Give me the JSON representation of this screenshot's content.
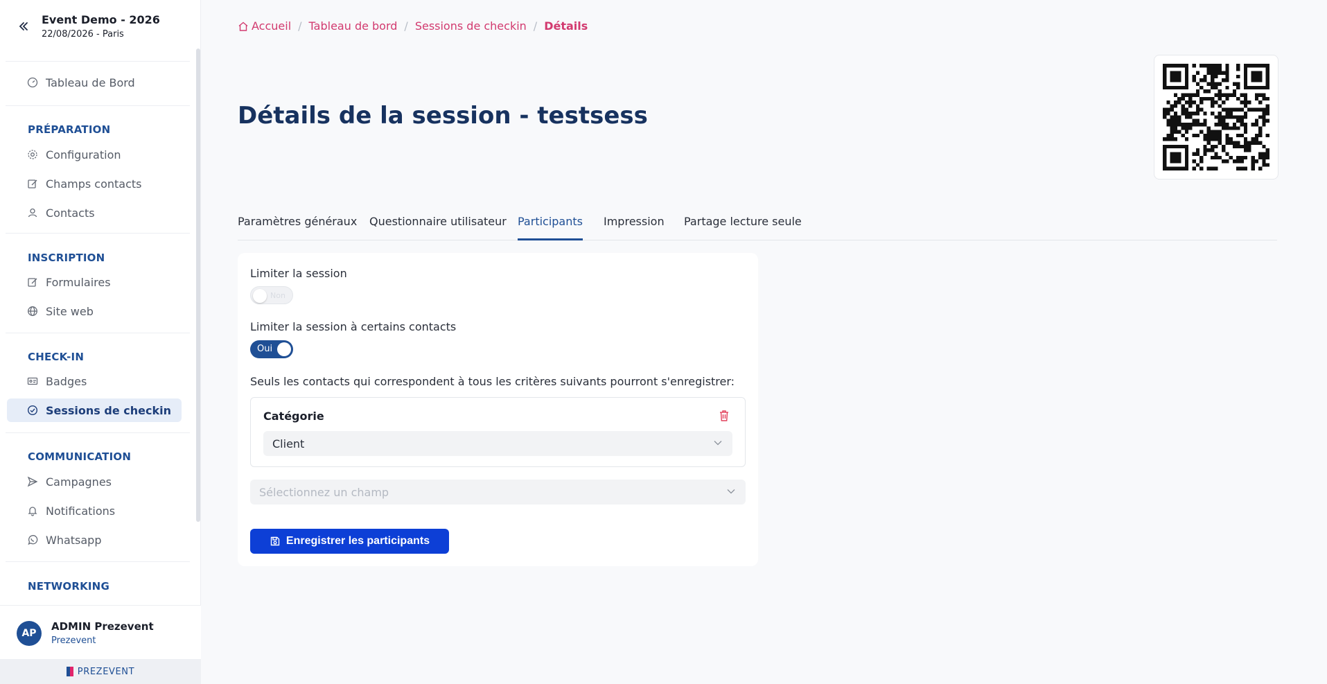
{
  "event": {
    "title": "Event Demo - 2026",
    "subtitle": "22/08/2026 - Paris"
  },
  "sidebar": {
    "dashboard": "Tableau de Bord",
    "sections": {
      "preparation": "PRÉPARATION",
      "inscription": "INSCRIPTION",
      "checkin": "CHECK-IN",
      "communication": "COMMUNICATION",
      "networking": "NETWORKING"
    },
    "items": {
      "configuration": "Configuration",
      "champs_contacts": "Champs contacts",
      "contacts": "Contacts",
      "formulaires": "Formulaires",
      "site_web": "Site web",
      "badges": "Badges",
      "sessions_checkin": "Sessions de checkin",
      "campagnes": "Campagnes",
      "notifications": "Notifications",
      "whatsapp": "Whatsapp"
    }
  },
  "user": {
    "initials": "AP",
    "name": "ADMIN Prezevent",
    "org": "Prezevent"
  },
  "brand": "PREZEVENT",
  "breadcrumb": {
    "home": "Accueil",
    "dashboard": "Tableau de bord",
    "sessions": "Sessions de checkin",
    "current": "Détails"
  },
  "page": {
    "title": "Détails de la session - testsess"
  },
  "tabs": {
    "general": "Paramètres généraux",
    "questionnaire": "Questionnaire utilisateur",
    "participants": "Participants",
    "impression": "Impression",
    "partage": "Partage lecture seule"
  },
  "form": {
    "limit_session_label": "Limiter la session",
    "limit_session_toggle": "Non",
    "limit_contacts_label": "Limiter la session à certains contacts",
    "limit_contacts_toggle": "Oui",
    "criteria_intro": "Seuls les contacts qui correspondent à tous les critères suivants pourront s'enregistrer:",
    "criterion_title": "Catégorie",
    "criterion_value": "Client",
    "field_placeholder": "Sélectionnez un champ",
    "save_label": "Enregistrer les participants"
  },
  "colors": {
    "accent": "#1f4f95",
    "breadcrumb": "#d23a6f",
    "save_button": "#0d3fd6"
  }
}
